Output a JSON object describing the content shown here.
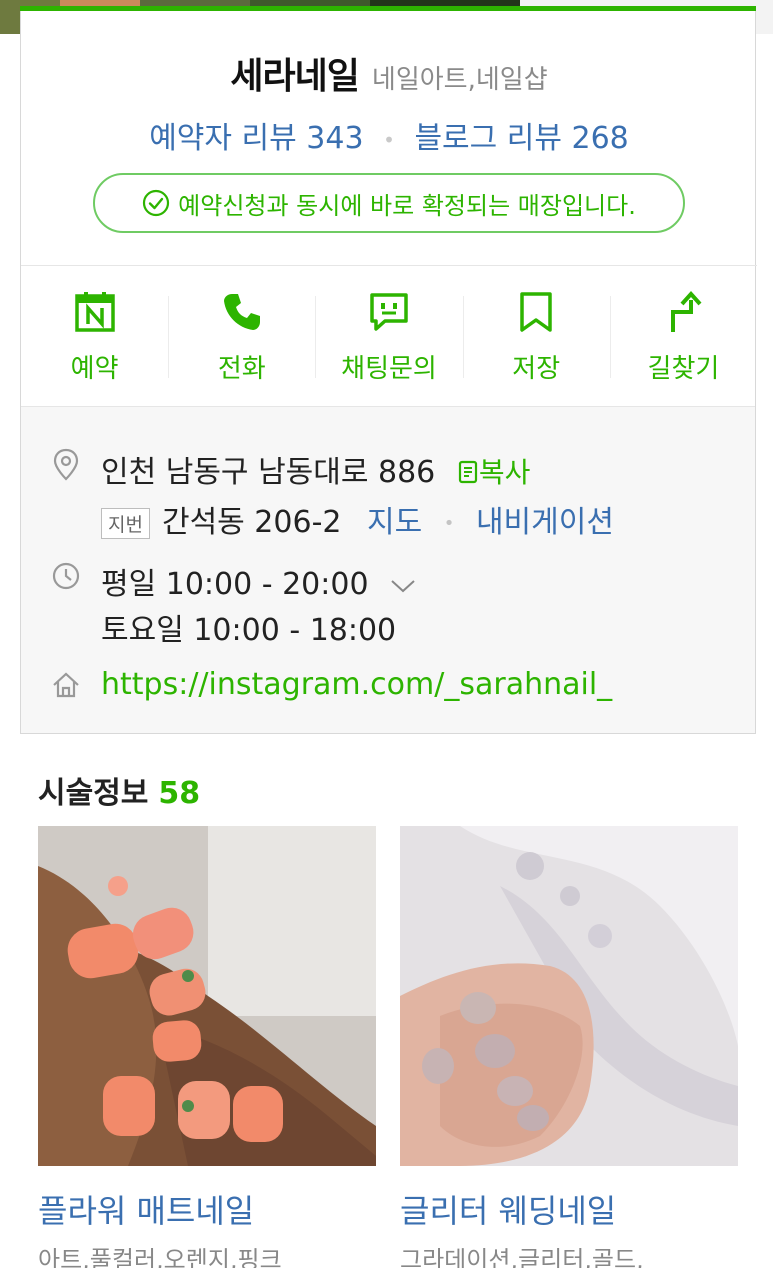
{
  "place": {
    "name": "세라네일",
    "category": "네일아트,네일샵"
  },
  "reviews": {
    "visitor": "예약자 리뷰 343",
    "blog": "블로그 리뷰 268"
  },
  "notice": "예약신청과 동시에 바로 확정되는 매장입니다.",
  "actions": [
    {
      "label": "예약",
      "icon": "calendar-n-icon"
    },
    {
      "label": "전화",
      "icon": "phone-icon"
    },
    {
      "label": "채팅문의",
      "icon": "chat-icon"
    },
    {
      "label": "저장",
      "icon": "bookmark-icon"
    },
    {
      "label": "길찾기",
      "icon": "directions-icon"
    }
  ],
  "info": {
    "address": "인천 남동구 남동대로 886",
    "copy_label": "복사",
    "jibun_tag": "지번",
    "jibun_address": "간석동 206-2",
    "map_link": "지도",
    "navigation_link": "내비게이션",
    "hours_weekday": "평일 10:00 - 20:00",
    "hours_saturday": "토요일 10:00 - 18:00",
    "website": "https://instagram.com/_sarahnail_"
  },
  "portfolio": {
    "title": "시술정보",
    "count": "58",
    "items": [
      {
        "title": "플라워 매트네일",
        "tags": "아트,풀컬러,오렌지,핑크"
      },
      {
        "title": "글리터 웨딩네일",
        "tags": "그라데이션,글리터,골드,"
      }
    ]
  },
  "colors": {
    "brand_green": "#2db400",
    "link_blue": "#3a6fb0"
  }
}
